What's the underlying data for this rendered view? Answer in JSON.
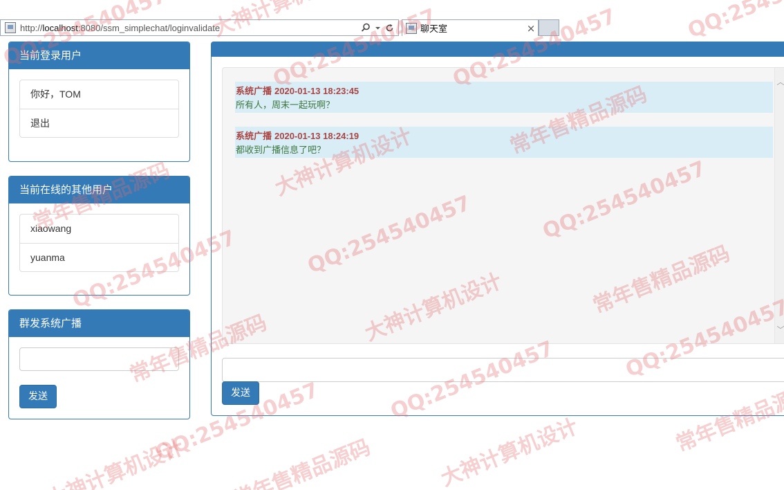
{
  "browser": {
    "url_scheme": "http://",
    "url_host": "localhost",
    "url_rest": ":8080/ssm_simplechat/loginvalidate",
    "search_icon": "search-icon",
    "dropdown_icon": "chevron-down-icon",
    "refresh_icon": "refresh-icon",
    "tab_title": "聊天室",
    "tab_close": "×"
  },
  "current_user_panel": {
    "title": "当前登录用户",
    "items": [
      {
        "label": "你好，TOM"
      },
      {
        "label": "退出"
      }
    ]
  },
  "online_users_panel": {
    "title": "当前在线的其他用户",
    "items": [
      {
        "label": "xiaowang"
      },
      {
        "label": "yuanma"
      }
    ]
  },
  "broadcast_panel": {
    "title": "群发系统广播",
    "input_value": "",
    "send_label": "发送"
  },
  "chat": {
    "messages": [
      {
        "sender": "系统广播",
        "time": "2020-01-13 18:23:45",
        "text": "所有人，周末一起玩啊？"
      },
      {
        "sender": "系统广播",
        "time": "2020-01-13 18:24:19",
        "text": "都收到广播信息了吧？"
      }
    ],
    "input_value": "",
    "send_label": "发送",
    "scroll_up": "︿",
    "scroll_down": "﹀"
  },
  "watermarks": {
    "texts": [
      "QQ:254540457",
      "大神计算机设计",
      "常年售精品源码"
    ],
    "color": "#e46e6e"
  },
  "colors": {
    "primary": "#337ab7",
    "message_bg": "#d9edf7",
    "message_head": "#a94442",
    "message_body": "#3c763d"
  }
}
